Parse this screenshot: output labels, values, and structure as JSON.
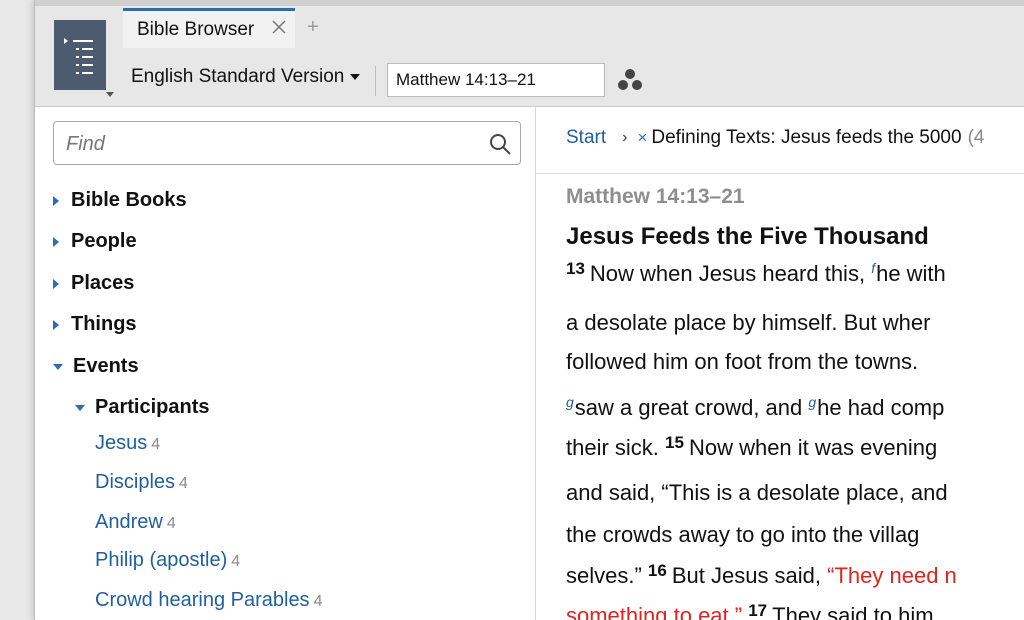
{
  "tab": {
    "title": "Bible Browser",
    "add": "+"
  },
  "toolbar": {
    "version": "English Standard Version",
    "reference": "Matthew 14:13–21"
  },
  "find": {
    "placeholder": "Find"
  },
  "tree": {
    "items": [
      {
        "label": "Bible Books"
      },
      {
        "label": "People"
      },
      {
        "label": "Places"
      },
      {
        "label": "Things"
      },
      {
        "label": "Events"
      }
    ],
    "participants": {
      "label": "Participants",
      "children": [
        {
          "label": "Jesus",
          "count": "4"
        },
        {
          "label": "Disciples",
          "count": "4"
        },
        {
          "label": "Andrew",
          "count": "4"
        },
        {
          "label": "Philip (apostle)",
          "count": "4"
        },
        {
          "label": "Crowd hearing Parables",
          "count": "4"
        }
      ]
    }
  },
  "breadcrumb": {
    "start": "Start",
    "arrow": "›",
    "remove": "×",
    "current": "Defining Texts: Jesus feeds the 5000",
    "count": "(4"
  },
  "passage": {
    "reference": "Matthew 14:13–21",
    "heading": "Jesus Feeds the Five Thousand",
    "l1": {
      "vnum": "13",
      "t1": "Now when Jesus heard this, ",
      "fn": "f",
      "t2": "he with"
    },
    "l2": "a desolate place by himself. But wher",
    "l3": "followed him on foot from the towns.",
    "l4": {
      "fn1": "g",
      "t1": "saw a great crowd, and ",
      "fn2": "g",
      "t2": "he had comp"
    },
    "l5": {
      "t1": "their sick. ",
      "vnum": "15",
      "t2": "Now when it was evening"
    },
    "l6": "and said, “This is a desolate place, and",
    "l7": "the crowds away to go into the villag",
    "l8": {
      "t1": "selves.” ",
      "vnum": "16",
      "t2": "But Jesus said, ",
      "red": "“They need n"
    },
    "l9": {
      "red": "something to eat.” ",
      "vnum": "17",
      "t2": "They said to him"
    }
  },
  "colors": {
    "accent": "#2a6db0",
    "link": "#1f5f9e",
    "words_of_christ": "#e0231e"
  }
}
